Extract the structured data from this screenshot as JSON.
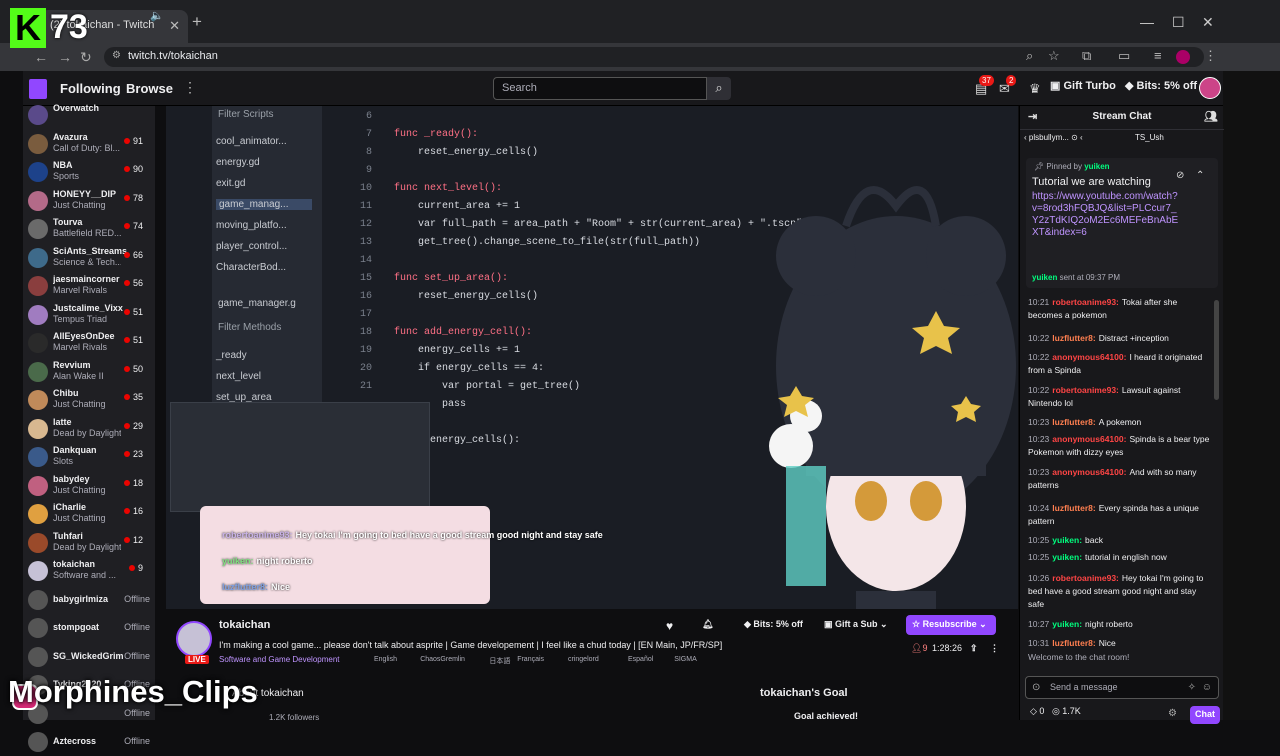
{
  "overlay": {
    "badge_letter": "K",
    "badge_number": "73",
    "watermark": "Morphines_Clips"
  },
  "browser": {
    "tab_title": "(2) tokaichan - Twitch",
    "url": "twitch.tv/tokaichan"
  },
  "twitch_header": {
    "following": "Following",
    "browse": "Browse",
    "search_placeholder": "Search",
    "notif_count": "37",
    "inbox_count": "2",
    "gift_turbo": "Gift Turbo",
    "bits": "Bits: 5% off"
  },
  "sidebar": {
    "channels": [
      {
        "name": "Overwatch",
        "game": "",
        "viewers": "",
        "offline": false,
        "avatar_color": "#5a4a8a"
      },
      {
        "name": "Avazura",
        "game": "Call of Duty: Bl...",
        "viewers": "91",
        "offline": false,
        "avatar_color": "#7a5c3e"
      },
      {
        "name": "NBA",
        "game": "Sports",
        "viewers": "90",
        "offline": false,
        "avatar_color": "#1d428a"
      },
      {
        "name": "HONEYY__DIP",
        "game": "Just Chatting",
        "viewers": "78",
        "offline": false,
        "avatar_color": "#b36a88"
      },
      {
        "name": "Tourva",
        "game": "Battlefield RED...",
        "viewers": "74",
        "offline": false,
        "avatar_color": "#6a6a6a"
      },
      {
        "name": "SciAnts_Streams",
        "game": "Science & Tech...",
        "viewers": "66",
        "offline": false,
        "avatar_color": "#3e6a8a"
      },
      {
        "name": "jaesmaincorner",
        "game": "Marvel Rivals",
        "viewers": "56",
        "offline": false,
        "avatar_color": "#8a3e3e"
      },
      {
        "name": "Justcalime_Vixx",
        "game": "Tempus Triad",
        "viewers": "51",
        "offline": false,
        "avatar_color": "#a07cc0"
      },
      {
        "name": "AllEyesOnDee",
        "game": "Marvel Rivals",
        "viewers": "51",
        "offline": false,
        "avatar_color": "#2a2a2a"
      },
      {
        "name": "Revvium",
        "game": "Alan Wake II",
        "viewers": "50",
        "offline": false,
        "avatar_color": "#4a6a4a"
      },
      {
        "name": "Chibu",
        "game": "Just Chatting",
        "viewers": "35",
        "offline": false,
        "avatar_color": "#c08a5a"
      },
      {
        "name": "latte",
        "game": "Dead by Daylight",
        "viewers": "29",
        "offline": false,
        "avatar_color": "#d8b890"
      },
      {
        "name": "Dankquan",
        "game": "Slots",
        "viewers": "23",
        "offline": false,
        "avatar_color": "#3a5a8a"
      },
      {
        "name": "babydey",
        "game": "Just Chatting",
        "viewers": "18",
        "offline": false,
        "avatar_color": "#c06080"
      },
      {
        "name": "iCharlie",
        "game": "Just Chatting",
        "viewers": "16",
        "offline": false,
        "avatar_color": "#e0a040"
      },
      {
        "name": "Tuhfari",
        "game": "Dead by Daylight",
        "viewers": "12",
        "offline": false,
        "avatar_color": "#9a4a2a"
      },
      {
        "name": "tokaichan",
        "game": "Software and ...",
        "viewers": "9",
        "offline": false,
        "avatar_color": "#c6c1d6"
      },
      {
        "name": "babygirlmiza",
        "game": "",
        "viewers": "",
        "offline": true,
        "avatar_color": "#555555"
      },
      {
        "name": "stompgoat",
        "game": "",
        "viewers": "",
        "offline": true,
        "avatar_color": "#555555"
      },
      {
        "name": "SG_WickedGrim",
        "game": "",
        "viewers": "",
        "offline": true,
        "avatar_color": "#555555"
      },
      {
        "name": "Tyking2020",
        "game": "",
        "viewers": "",
        "offline": true,
        "avatar_color": "#555555"
      },
      {
        "name": "",
        "game": "",
        "viewers": "",
        "offline": true,
        "avatar_color": "#555555"
      },
      {
        "name": "Aztecross",
        "game": "",
        "viewers": "",
        "offline": true,
        "avatar_color": "#555555"
      }
    ],
    "offline_label": "Offline"
  },
  "ide": {
    "filter_scripts": "Filter Scripts",
    "scripts": [
      "cool_animator...",
      "energy.gd",
      "exit.gd",
      "game_manag...",
      "moving_platfo...",
      "player_control...",
      "CharacterBod..."
    ],
    "current_script": "game_manager.g",
    "filter_methods": "Filter Methods",
    "methods": [
      "_ready",
      "next_level",
      "set_up_area"
    ],
    "code_lines": [
      {
        "n": "6",
        "text": ""
      },
      {
        "n": "7",
        "text": "func _ready():"
      },
      {
        "n": "8",
        "text": "    reset_energy_cells()"
      },
      {
        "n": "9",
        "text": ""
      },
      {
        "n": "10",
        "text": "func next_level():"
      },
      {
        "n": "11",
        "text": "    current_area += 1"
      },
      {
        "n": "12",
        "text": "    var full_path = area_path + \"Room\" + str(current_area) + \".tscn\""
      },
      {
        "n": "13",
        "text": "    get_tree().change_scene_to_file(str(full_path))"
      },
      {
        "n": "14",
        "text": ""
      },
      {
        "n": "15",
        "text": "func set_up_area():"
      },
      {
        "n": "16",
        "text": "    reset_energy_cells()"
      },
      {
        "n": "17",
        "text": ""
      },
      {
        "n": "18",
        "text": "func add_energy_cell():"
      },
      {
        "n": "19",
        "text": "    energy_cells += 1"
      },
      {
        "n": "20",
        "text": "    if energy_cells == 4:"
      },
      {
        "n": "21",
        "text": "        var portal = get_tree()"
      },
      {
        "n": "",
        "text": "        pass"
      },
      {
        "n": "",
        "text": ""
      },
      {
        "n": "",
        "text": "reset_energy_cells():"
      }
    ]
  },
  "stream_chat_overlay": [
    {
      "user": "robertoanime93:",
      "text": "Hey tokai I'm going to bed have a good stream good night and stay safe"
    },
    {
      "user": "yuiken:",
      "text": "night roberto"
    },
    {
      "user": "luzflutter8:",
      "text": "Nice"
    }
  ],
  "channel": {
    "name": "tokaichan",
    "live": "LIVE",
    "title": "I'm making a cool game... please don't talk about asprite | Game developement | I feel like a chud today | [EN Main, JP/FR/SP]",
    "category": "Software and Game Development",
    "tags": [
      "English",
      "ChaosGremlin",
      "日本語",
      "Français",
      "cringelord",
      "Español",
      "SIGMA"
    ],
    "bits": "Bits: 5% off",
    "gift_sub": "Gift a Sub",
    "resubscribe": "Resubscribe",
    "viewers": "9",
    "uptime": "1:28:26",
    "about": "About tokaichan",
    "followers": "1.2K followers",
    "goal_title": "tokaichan's Goal",
    "goal_status": "Goal achieved!"
  },
  "chat": {
    "header": "Stream Chat",
    "gift_row": "plsbullym...",
    "gift_row_2": "TS_Ush",
    "pinned_by": "Pinned by",
    "pinned_user": "yuiken",
    "pinned_title": "Tutorial we are watching",
    "pinned_link": "https://www.youtube.com/watch?v=8rod3hFQBJQ&list=PLCcur7_Y2zTdKIQ2oM2Ec6MEFeBnAbEXT&index=6",
    "pinned_sent_by": "yuiken",
    "pinned_sent": "sent at 09:37 PM",
    "messages": [
      {
        "time": "10:21",
        "user": "robertoanime93:",
        "color": "red",
        "text": "Tokai after she becomes a pokemon"
      },
      {
        "time": "10:22",
        "user": "luzflutter8:",
        "color": "org",
        "text": "Distract +inception"
      },
      {
        "time": "10:22",
        "user": "anonymous64100:",
        "color": "red",
        "text": "I heard it originated from a Spinda"
      },
      {
        "time": "10:22",
        "user": "robertoanime93:",
        "color": "red",
        "text": "Lawsuit against Nintendo lol"
      },
      {
        "time": "10:23",
        "user": "luzflutter8:",
        "color": "org",
        "text": "A pokemon"
      },
      {
        "time": "10:23",
        "user": "anonymous64100:",
        "color": "red",
        "text": "Spinda is a bear type Pokemon with dizzy eyes"
      },
      {
        "time": "10:23",
        "user": "anonymous64100:",
        "color": "red",
        "text": "And with so many patterns"
      },
      {
        "time": "10:24",
        "user": "luzflutter8:",
        "color": "org",
        "text": "Every spinda has a unique pattern"
      },
      {
        "time": "10:25",
        "user": "yuiken:",
        "color": "grn",
        "text": "back"
      },
      {
        "time": "10:25",
        "user": "yuiken:",
        "color": "grn",
        "text": "tutorial in english now"
      },
      {
        "time": "10:26",
        "user": "robertoanime93:",
        "color": "red",
        "text": "Hey tokai I'm going to bed have a good stream good night and stay safe"
      },
      {
        "time": "10:27",
        "user": "yuiken:",
        "color": "grn",
        "text": "night roberto"
      },
      {
        "time": "10:31",
        "user": "luzflutter8:",
        "color": "org",
        "text": "Nice"
      }
    ],
    "welcome": "Welcome to the chat room!",
    "send_placeholder": "Send a message",
    "bits_count": "0",
    "points": "1.7K",
    "chat_button": "Chat"
  }
}
